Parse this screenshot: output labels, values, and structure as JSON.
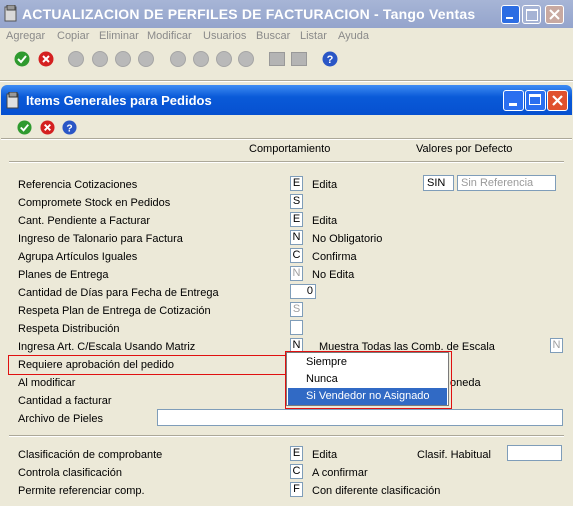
{
  "outer_window": {
    "title": "ACTUALIZACION DE PERFILES DE FACTURACION - Tango Ventas",
    "menu": [
      "Agregar",
      "Copiar",
      "Eliminar",
      "Modificar",
      "Usuarios",
      "Buscar",
      "Listar",
      "Ayuda"
    ]
  },
  "inner_window": {
    "title": "Items Generales para Pedidos",
    "col_behavior": "Comportamiento",
    "col_defaults": "Valores por Defecto"
  },
  "rows": [
    {
      "label": "Referencia Cotizaciones",
      "code": "E",
      "desc": "Edita"
    },
    {
      "label": "Compromete Stock en Pedidos",
      "code": "S",
      "desc": ""
    },
    {
      "label": "Cant. Pendiente a Facturar",
      "code": "E",
      "desc": "Edita"
    },
    {
      "label": "Ingreso de Talonario para Factura",
      "code": "N",
      "desc": "No Obligatorio"
    },
    {
      "label": "Agrupa Artículos Iguales",
      "code": "C",
      "desc": "Confirma"
    },
    {
      "label": "Planes de Entrega",
      "code": "N",
      "desc": "No Edita"
    },
    {
      "label": "Cantidad de Días para Fecha de Entrega",
      "code": "0",
      "desc": ""
    },
    {
      "label": "Respeta Plan de Entrega de Cotización",
      "code": "S",
      "desc": ""
    },
    {
      "label": "Respeta Distribución",
      "code": "",
      "desc": ""
    },
    {
      "label": "Ingresa Art. C/Escala Usando Matriz",
      "code": "N",
      "desc": "Muestra Todas las Comb. de Escala"
    },
    {
      "label": "Requiere aprobación del pedido",
      "code": "",
      "desc": ""
    },
    {
      "label": "Al modificar",
      "code": "",
      "desc": "oneda"
    },
    {
      "label": "Cantidad a facturar",
      "code": "",
      "desc": ""
    },
    {
      "label": "Archivo de Pieles",
      "code": "",
      "desc": ""
    }
  ],
  "ref_default": {
    "code": "SIN",
    "desc": "Sin Referencia"
  },
  "escala_right_code": "N",
  "bottom_rows": [
    {
      "label": "Clasificación de comprobante",
      "code": "E",
      "desc": "Edita"
    },
    {
      "label": "Controla clasificación",
      "code": "C",
      "desc": "A confirmar"
    },
    {
      "label": "Permite referenciar comp.",
      "code": "F",
      "desc": "Con diferente clasificación"
    }
  ],
  "clasif_habitual_label": "Clasif. Habitual",
  "dropdown": {
    "items": [
      "Siempre",
      "Nunca",
      "Si Vendedor no Asignado"
    ],
    "selected": 2
  },
  "colors": {
    "title_blue": "#0a5ad8",
    "highlight": "#316ac5",
    "annotation_red": "#e01010"
  }
}
